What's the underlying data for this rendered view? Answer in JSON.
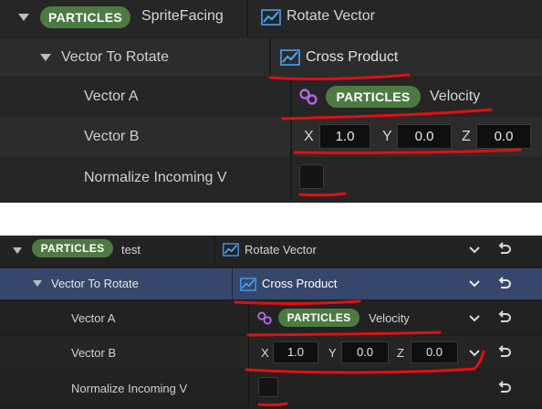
{
  "top": {
    "header": {
      "pill": "PARTICLES",
      "name": "SpriteFacing",
      "function": "Rotate Vector"
    },
    "vector_to_rotate": {
      "label": "Vector To Rotate",
      "value": "Cross Product"
    },
    "vector_a": {
      "label": "Vector A",
      "pill": "PARTICLES",
      "value": "Velocity"
    },
    "vector_b": {
      "label": "Vector B",
      "x_label": "X",
      "x": "1.0",
      "y_label": "Y",
      "y": "0.0",
      "z_label": "Z",
      "z": "0.0"
    },
    "normalize": {
      "label": "Normalize Incoming V"
    }
  },
  "bottom": {
    "header": {
      "pill": "PARTICLES",
      "name": "test",
      "function": "Rotate Vector"
    },
    "vector_to_rotate": {
      "label": "Vector To Rotate",
      "value": "Cross Product"
    },
    "vector_a": {
      "label": "Vector A",
      "pill": "PARTICLES",
      "value": "Velocity"
    },
    "vector_b": {
      "label": "Vector B",
      "x_label": "X",
      "x": "1.0",
      "y_label": "Y",
      "y": "0.0",
      "z_label": "Z",
      "z": "0.0"
    },
    "normalize": {
      "label": "Normalize Incoming V"
    }
  },
  "icons": {
    "expand": "triangle-down-icon",
    "graph": "graph-line-icon",
    "link": "link-icon",
    "dropdown": "chevron-down-icon",
    "reset": "reset-arrow-icon"
  },
  "colors": {
    "particles_pill": "#4d7a43",
    "graph_icon": "#4aa8ff",
    "link_icon": "#b266e0",
    "annotation": "#e01010",
    "selected_row": "#37476b"
  }
}
